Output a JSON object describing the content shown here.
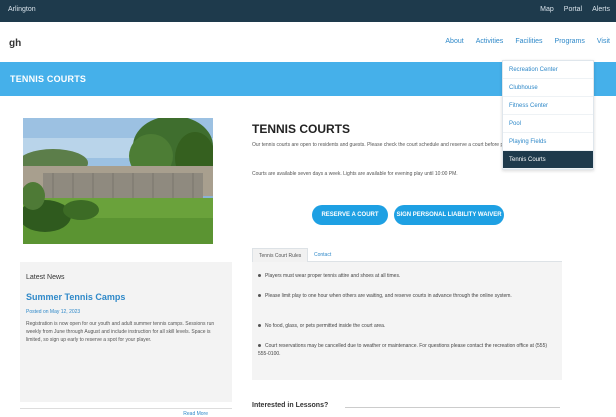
{
  "topbar": {
    "brand": "Arlington",
    "links": [
      "Map",
      "Portal",
      "Alerts"
    ]
  },
  "header": {
    "logo": "gh",
    "nav": [
      "About",
      "Activities",
      "Facilities",
      "Programs",
      "Visit"
    ]
  },
  "dropdown": {
    "items": [
      "Recreation Center",
      "Clubhouse",
      "Fitness Center",
      "Pool",
      "Playing Fields",
      "Tennis Courts"
    ],
    "active_index": 5
  },
  "banner": {
    "title": "TENNIS COURTS"
  },
  "sidebar": {
    "label": "Latest News",
    "title": "Summer Tennis Camps",
    "date": "Posted on May 12, 2023",
    "text": "Registration is now open for our youth and adult summer tennis camps. Sessions run weekly from June through August and include instruction for all skill levels. Space is limited, so sign up early to reserve a spot for your player.",
    "footer_link": "Read More"
  },
  "main": {
    "title": "TENNIS COURTS",
    "description": "Our tennis courts are open to residents and guests. Please check the court schedule and reserve a court before playing.",
    "description2": "Courts are available seven days a week. Lights are available for evening play until 10:00 PM.",
    "reserve_button": "RESERVE A COURT",
    "waiver_button": "SIGN PERSONAL LIABILITY WAIVER",
    "tabs": [
      "Tennis Court Rules",
      "Contact"
    ],
    "rules": [
      "Players must wear proper tennis attire and shoes at all times.",
      "Please limit play to one hour when others are waiting, and reserve courts in advance through the online system.",
      "No food, glass, or pets permitted inside the court area.",
      "Court reservations may be cancelled due to weather or maintenance. For questions please contact the recreation office at (555) 555-0100."
    ]
  },
  "interested": {
    "label": "Interested in Lessons?"
  },
  "colors": {
    "topbar": "#1e3a4c",
    "banner": "#45b0ea",
    "accent": "#1ea0e3",
    "link": "#2f89c9"
  }
}
